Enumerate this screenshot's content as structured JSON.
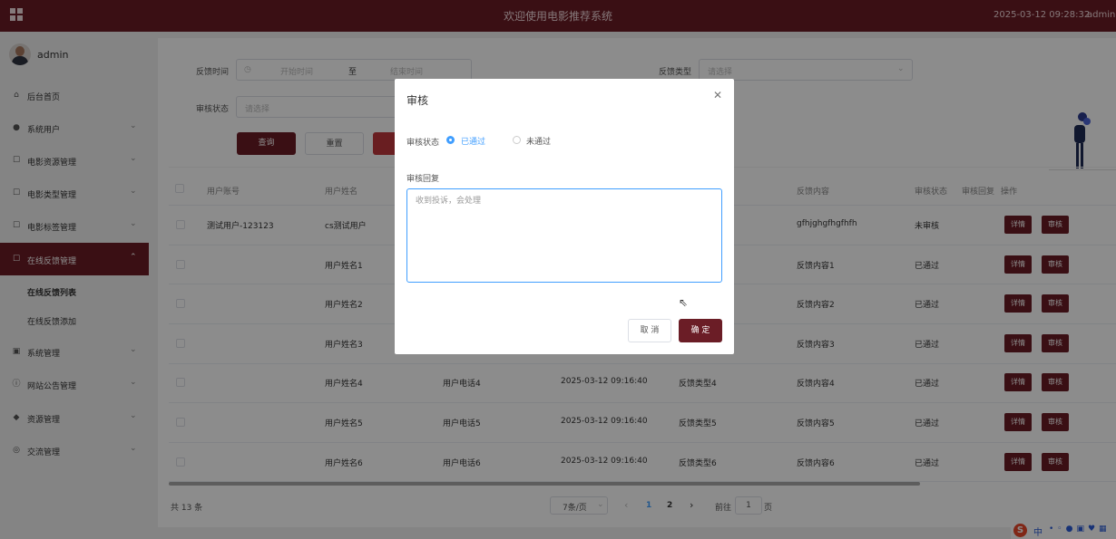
{
  "topbar": {
    "title": "欢迎使用电影推荐系统",
    "datetime": "2025-03-12 09:28:32",
    "user": "admin"
  },
  "sidebar": {
    "username": "admin",
    "items": [
      {
        "label": "后台首页",
        "icon": "home-icon"
      },
      {
        "label": "系统用户",
        "icon": "user-icon"
      },
      {
        "label": "电影资源管理",
        "icon": "edit-icon"
      },
      {
        "label": "电影类型管理",
        "icon": "edit-icon"
      },
      {
        "label": "电影标签管理",
        "icon": "edit-icon"
      },
      {
        "label": "在线反馈管理",
        "icon": "edit-icon"
      },
      {
        "label": "系统管理",
        "icon": "image-icon"
      },
      {
        "label": "网站公告管理",
        "icon": "info-icon"
      },
      {
        "label": "资源管理",
        "icon": "location-icon"
      },
      {
        "label": "交流管理",
        "icon": "chat-icon"
      }
    ],
    "subitems": [
      "在线反馈列表",
      "在线反馈添加"
    ]
  },
  "filters": {
    "time_label": "反馈时间",
    "start_placeholder": "开始时间",
    "range_sep": "至",
    "end_placeholder": "结束时间",
    "type_label": "反馈类型",
    "type_placeholder": "请选择",
    "status_label": "审核状态",
    "status_placeholder": "请选择",
    "search_btn": "查询",
    "reset_btn": "重置"
  },
  "table": {
    "headers": [
      "用户账号",
      "用户姓名",
      "反馈内容",
      "审核状态",
      "审核回复",
      "操作"
    ],
    "rows": [
      {
        "account": "测试用户-123123",
        "name": "cs测试用户",
        "phone": "",
        "time": "",
        "type": "",
        "content": "gfhjghgfhgfhfh",
        "status": "未审核"
      },
      {
        "account": "",
        "name": "用户姓名1",
        "phone": "",
        "time": "",
        "type": "",
        "content": "反馈内容1",
        "status": "已通过"
      },
      {
        "account": "",
        "name": "用户姓名2",
        "phone": "",
        "time": "",
        "type": "",
        "content": "反馈内容2",
        "status": "已通过"
      },
      {
        "account": "",
        "name": "用户姓名3",
        "phone": "",
        "time": "",
        "type": "",
        "content": "反馈内容3",
        "status": "已通过"
      },
      {
        "account": "",
        "name": "用户姓名4",
        "phone": "用户电话4",
        "time": "2025-03-12 09:16:40",
        "type": "反馈类型4",
        "content": "反馈内容4",
        "status": "已通过"
      },
      {
        "account": "",
        "name": "用户姓名5",
        "phone": "用户电话5",
        "time": "2025-03-12 09:16:40",
        "type": "反馈类型5",
        "content": "反馈内容5",
        "status": "已通过"
      },
      {
        "account": "",
        "name": "用户姓名6",
        "phone": "用户电话6",
        "time": "2025-03-12 09:16:40",
        "type": "反馈类型6",
        "content": "反馈内容6",
        "status": "已通过"
      }
    ],
    "detail_btn": "详情",
    "audit_btn": "审核"
  },
  "pagination": {
    "total": "共 13 条",
    "page_size": "7条/页",
    "prev": "‹",
    "pages": [
      "1",
      "2"
    ],
    "next": "›",
    "goto_label": "前往",
    "goto_value": "1",
    "page_suffix": "页"
  },
  "dialog": {
    "title": "审核",
    "status_label": "审核状态",
    "option_pass": "已通过",
    "option_fail": "未通过",
    "reply_label": "审核回复",
    "reply_value": "收到投诉，会处理",
    "cancel": "取 消",
    "confirm": "确 定"
  },
  "ime": {
    "zh": "中"
  },
  "colors": {
    "brand": "#6b1d26",
    "radio": "#409eff"
  }
}
